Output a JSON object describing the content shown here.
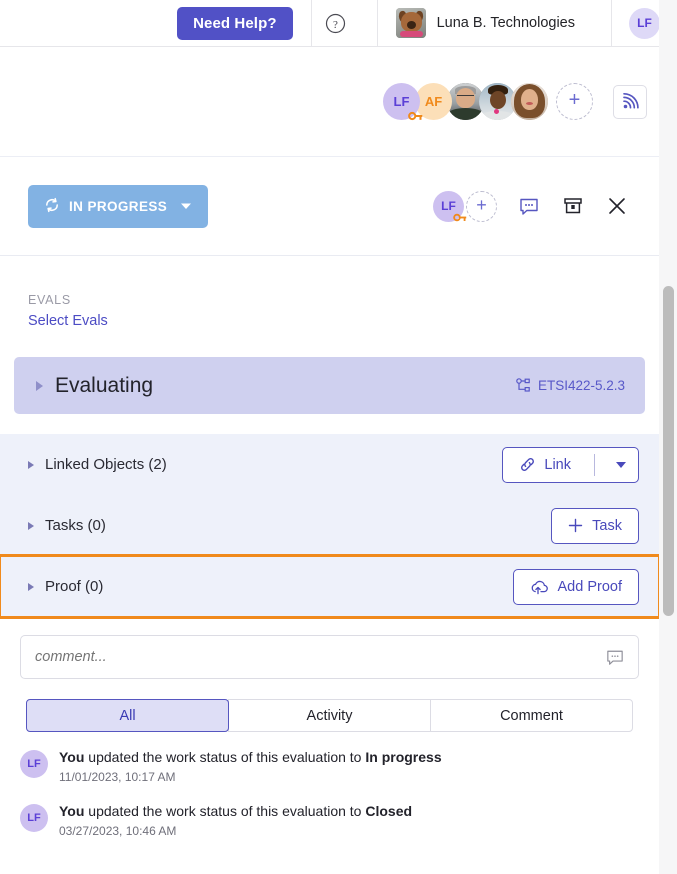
{
  "topbar": {
    "need_help_label": "Need Help?",
    "help_icon": "question-circle-icon",
    "org_name": "Luna B. Technologies",
    "org_thumb_icon": "org-logo-dog-photo",
    "user_initials": "LF"
  },
  "avatar_strip": {
    "members": [
      {
        "initials": "LF",
        "type": "initials",
        "badge": "key-badge-icon"
      },
      {
        "initials": "AF",
        "type": "initials",
        "badge": null
      },
      {
        "initials": "",
        "type": "photo",
        "photo": "person-photo-1"
      },
      {
        "initials": "",
        "type": "photo",
        "photo": "person-photo-2"
      },
      {
        "initials": "",
        "type": "photo",
        "photo": "person-photo-3"
      }
    ],
    "add_label": "+",
    "feed_icon": "rss-feed-icon"
  },
  "panel_header": {
    "status_label": "IN PROGRESS",
    "status_icon": "refresh-icon",
    "status_caret": "chevron-down-icon",
    "status_color": "#82b2e3",
    "assignee_initials": "LF",
    "assignee_badge": "key-badge-icon",
    "add_assignee_label": "+",
    "comment_icon": "comment-bubble-icon",
    "archive_icon": "archive-box-icon",
    "close_icon": "close-x-icon"
  },
  "evals": {
    "label": "EVALS",
    "link_label": "Select Evals"
  },
  "evaluating": {
    "title": "Evaluating",
    "toggle_icon": "triangle-right-icon",
    "tag_icon": "hierarchy-node-icon",
    "tag_label": "ETSI422-5.2.3",
    "background": "#cfd0ef"
  },
  "sections": [
    {
      "name": "linked-objects",
      "title": "Linked Objects (2)",
      "button": {
        "label": "Link",
        "icon": "link-chain-icon",
        "has_dropdown": true
      },
      "highlighted": false
    },
    {
      "name": "tasks",
      "title": "Tasks (0)",
      "button": {
        "label": "Task",
        "icon": "plus-icon",
        "has_dropdown": false
      },
      "highlighted": false
    },
    {
      "name": "proof",
      "title": "Proof (0)",
      "button": {
        "label": "Add Proof",
        "icon": "cloud-upload-icon",
        "has_dropdown": false
      },
      "highlighted": true,
      "highlight_color": "#f08a1c"
    }
  ],
  "comment": {
    "placeholder": "comment...",
    "value": "",
    "icon": "comment-bubble-icon"
  },
  "tabs": [
    {
      "label": "All",
      "active": true
    },
    {
      "label": "Activity",
      "active": false
    },
    {
      "label": "Comment",
      "active": false
    }
  ],
  "activity": [
    {
      "avatar_initials": "LF",
      "actor": "You",
      "text": " updated the work status of this evaluation to ",
      "target": "In progress",
      "timestamp": "11/01/2023, 10:17 AM"
    },
    {
      "avatar_initials": "LF",
      "actor": "You",
      "text": " updated the work status of this evaluation to ",
      "target": "Closed",
      "timestamp": "03/27/2023, 10:46 AM"
    }
  ],
  "scrollbar": {
    "name": "vertical-scrollbar"
  }
}
